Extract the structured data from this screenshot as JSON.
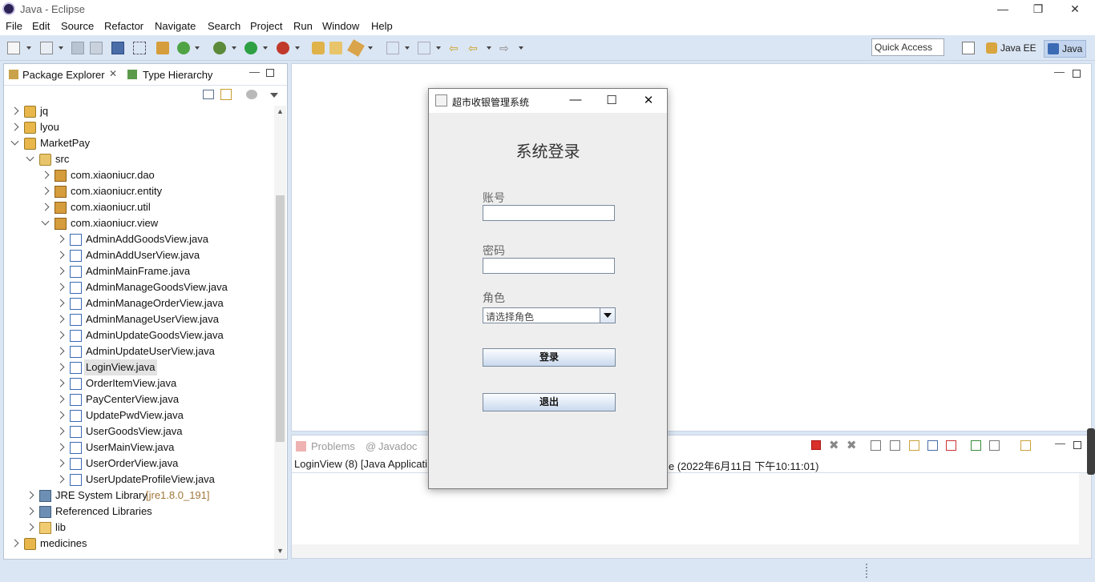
{
  "window": {
    "title": "Java - Eclipse",
    "minimize": "—",
    "restore": "❐",
    "close": "✕"
  },
  "menu": [
    "File",
    "Edit",
    "Source",
    "Refactor",
    "Navigate",
    "Search",
    "Project",
    "Run",
    "Window",
    "Help"
  ],
  "toolbar": {
    "quick_access": "Quick Access",
    "perspectives": [
      "Java EE",
      "Java"
    ]
  },
  "package_explorer": {
    "tabs": [
      "Package Explorer",
      "Type Hierarchy"
    ],
    "tree": [
      {
        "label": "jq",
        "state": "c",
        "icon": "project-icon",
        "indent": 0
      },
      {
        "label": "lyou",
        "state": "c",
        "icon": "project-icon",
        "indent": 0
      },
      {
        "label": "MarketPay",
        "state": "e",
        "icon": "project-icon",
        "indent": 0
      },
      {
        "label": "src",
        "state": "e",
        "icon": "source-folder-icon",
        "indent": 1
      },
      {
        "label": "com.xiaoniucr.dao",
        "state": "c",
        "icon": "package-icon",
        "indent": 2
      },
      {
        "label": "com.xiaoniucr.entity",
        "state": "c",
        "icon": "package-icon",
        "indent": 2
      },
      {
        "label": "com.xiaoniucr.util",
        "state": "c",
        "icon": "package-icon",
        "indent": 2
      },
      {
        "label": "com.xiaoniucr.view",
        "state": "e",
        "icon": "package-icon",
        "indent": 2
      },
      {
        "label": "AdminAddGoodsView.java",
        "state": "c",
        "icon": "java-file-icon",
        "indent": 3
      },
      {
        "label": "AdminAddUserView.java",
        "state": "c",
        "icon": "java-file-icon",
        "indent": 3
      },
      {
        "label": "AdminMainFrame.java",
        "state": "c",
        "icon": "java-file-icon",
        "indent": 3
      },
      {
        "label": "AdminManageGoodsView.java",
        "state": "c",
        "icon": "java-file-icon",
        "indent": 3
      },
      {
        "label": "AdminManageOrderView.java",
        "state": "c",
        "icon": "java-file-icon",
        "indent": 3
      },
      {
        "label": "AdminManageUserView.java",
        "state": "c",
        "icon": "java-file-icon",
        "indent": 3
      },
      {
        "label": "AdminUpdateGoodsView.java",
        "state": "c",
        "icon": "java-file-icon",
        "indent": 3
      },
      {
        "label": "AdminUpdateUserView.java",
        "state": "c",
        "icon": "java-file-icon",
        "indent": 3
      },
      {
        "label": "LoginView.java",
        "state": "c",
        "icon": "java-file-icon",
        "indent": 3,
        "selected": true
      },
      {
        "label": "OrderItemView.java",
        "state": "c",
        "icon": "java-file-icon",
        "indent": 3
      },
      {
        "label": "PayCenterView.java",
        "state": "c",
        "icon": "java-file-icon",
        "indent": 3
      },
      {
        "label": "UpdatePwdView.java",
        "state": "c",
        "icon": "java-file-icon",
        "indent": 3
      },
      {
        "label": "UserGoodsView.java",
        "state": "c",
        "icon": "java-file-icon",
        "indent": 3
      },
      {
        "label": "UserMainView.java",
        "state": "c",
        "icon": "java-file-icon",
        "indent": 3
      },
      {
        "label": "UserOrderView.java",
        "state": "c",
        "icon": "java-file-icon",
        "indent": 3
      },
      {
        "label": "UserUpdateProfileView.java",
        "state": "c",
        "icon": "java-file-icon",
        "indent": 3
      },
      {
        "label": "JRE System Library",
        "suffix": "[jre1.8.0_191]",
        "state": "c",
        "icon": "library-icon",
        "indent": 1
      },
      {
        "label": "Referenced Libraries",
        "state": "c",
        "icon": "library-icon",
        "indent": 1
      },
      {
        "label": "lib",
        "state": "c",
        "icon": "folder-icon",
        "indent": 1
      },
      {
        "label": "medicines",
        "state": "c",
        "icon": "project-icon",
        "indent": 0
      }
    ]
  },
  "console": {
    "tabs": [
      "Problems",
      "Javadoc"
    ],
    "line_left": "LoginView (8) [Java Applicati",
    "line_right": "e (2022年6月11日 下午10:11:01)"
  },
  "dialog": {
    "title": "超市收银管理系统",
    "heading": "系统登录",
    "account_label": "账号",
    "password_label": "密码",
    "role_label": "角色",
    "role_placeholder": "请选择角色",
    "login_button": "登录",
    "exit_button": "退出",
    "minimize": "—",
    "maximize": "☐",
    "close": "✕"
  },
  "colors": {
    "chrome_bg": "#dbe6f4",
    "folder": "#e8b64a",
    "java": "#3b6bb5"
  }
}
